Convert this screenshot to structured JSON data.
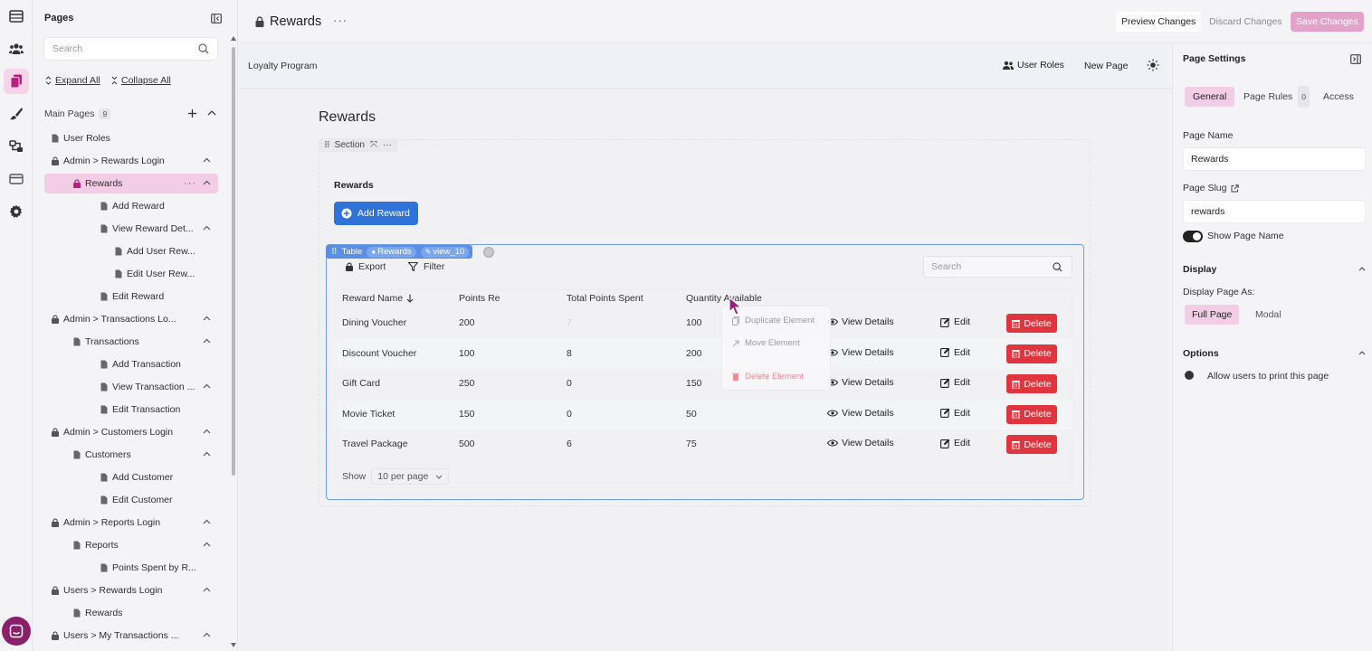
{
  "pages_panel": {
    "title": "Pages",
    "search_placeholder": "Search",
    "expand_all": "Expand All",
    "collapse_all": "Collapse All",
    "main_pages_label": "Main Pages",
    "main_pages_count": "9",
    "tree": [
      {
        "label": "User Roles",
        "icon": "page-icon",
        "chevron": false
      },
      {
        "label": "Admin > Rewards Login",
        "icon": "lock-icon",
        "chevron": true
      },
      {
        "label": "Rewards",
        "icon": "lock-icon",
        "chevron": true,
        "selected": true
      },
      {
        "label": "Add Reward",
        "icon": "page-icon",
        "chevron": false
      },
      {
        "label": "View Reward Det...",
        "icon": "page-icon",
        "chevron": true
      },
      {
        "label": "Add User Rew...",
        "icon": "page-icon",
        "chevron": false
      },
      {
        "label": "Edit User Rew...",
        "icon": "page-icon",
        "chevron": false
      },
      {
        "label": "Edit Reward",
        "icon": "page-icon",
        "chevron": false
      },
      {
        "label": "Admin > Transactions Lo...",
        "icon": "lock-icon",
        "chevron": true
      },
      {
        "label": "Transactions",
        "icon": "page-icon",
        "chevron": true
      },
      {
        "label": "Add Transaction",
        "icon": "page-icon",
        "chevron": false
      },
      {
        "label": "View Transaction ...",
        "icon": "page-icon",
        "chevron": true
      },
      {
        "label": "Edit Transaction",
        "icon": "page-icon",
        "chevron": false
      },
      {
        "label": "Admin > Customers Login",
        "icon": "lock-icon",
        "chevron": true
      },
      {
        "label": "Customers",
        "icon": "page-icon",
        "chevron": true
      },
      {
        "label": "Add Customer",
        "icon": "page-icon",
        "chevron": false
      },
      {
        "label": "Edit Customer",
        "icon": "page-icon",
        "chevron": false
      },
      {
        "label": "Admin > Reports Login",
        "icon": "lock-icon",
        "chevron": true
      },
      {
        "label": "Reports",
        "icon": "page-icon",
        "chevron": true
      },
      {
        "label": "Points Spent by R...",
        "icon": "page-icon",
        "chevron": false
      },
      {
        "label": "Users > Rewards Login",
        "icon": "lock-icon",
        "chevron": true
      },
      {
        "label": "Rewards",
        "icon": "page-icon",
        "chevron": false
      },
      {
        "label": "Users > My Transactions ...",
        "icon": "lock-icon",
        "chevron": true
      }
    ]
  },
  "topbar": {
    "page_title": "Rewards",
    "preview": "Preview Changes",
    "discard": "Discard Changes",
    "save": "Save Changes"
  },
  "preview_header": {
    "brand": "Loyalty Program",
    "user_roles": "User Roles",
    "new_page": "New Page"
  },
  "page": {
    "heading": "Rewards",
    "section_tag": "Section",
    "section_title": "Rewards",
    "add_button": "Add Reward"
  },
  "table": {
    "tag_label": "Table",
    "tag_source": "Rewards",
    "tag_view": "view_10",
    "export": "Export",
    "filter": "Filter",
    "search_placeholder": "Search",
    "headers": [
      "Reward Name",
      "Points Re",
      "Total Points Spent",
      "Quantity Available"
    ],
    "rows": [
      {
        "name": "Dining Voucher",
        "points": "200",
        "spent": "7",
        "qty": "100"
      },
      {
        "name": "Discount Voucher",
        "points": "100",
        "spent": "8",
        "qty": "200"
      },
      {
        "name": "Gift Card",
        "points": "250",
        "spent": "0",
        "qty": "150"
      },
      {
        "name": "Movie Ticket",
        "points": "150",
        "spent": "0",
        "qty": "50"
      },
      {
        "name": "Travel Package",
        "points": "500",
        "spent": "6",
        "qty": "75"
      }
    ],
    "actions": {
      "view": "View Details",
      "edit": "Edit",
      "delete": "Delete"
    },
    "footer_show": "Show",
    "per_page": "10 per page"
  },
  "context_menu": {
    "duplicate": "Duplicate Element",
    "move": "Move Element",
    "delete": "Delete Element"
  },
  "settings": {
    "title": "Page Settings",
    "tabs": {
      "general": "General",
      "rules": "Page Rules",
      "rules_count": "0",
      "access": "Access"
    },
    "page_name_label": "Page Name",
    "page_name_value": "Rewards",
    "slug_label": "Page Slug",
    "slug_value": "rewards",
    "show_name": "Show Page Name",
    "display_title": "Display",
    "display_as": "Display Page As:",
    "full_page": "Full Page",
    "modal": "Modal",
    "options_title": "Options",
    "print_option": "Allow users to print this page"
  },
  "colors": {
    "accent_pink": "#f3cde6",
    "save_pink": "#e3a3c9",
    "primary_blue": "#2f73d9",
    "danger_red": "#e0343f",
    "brand_purple": "#8a1f6a"
  }
}
